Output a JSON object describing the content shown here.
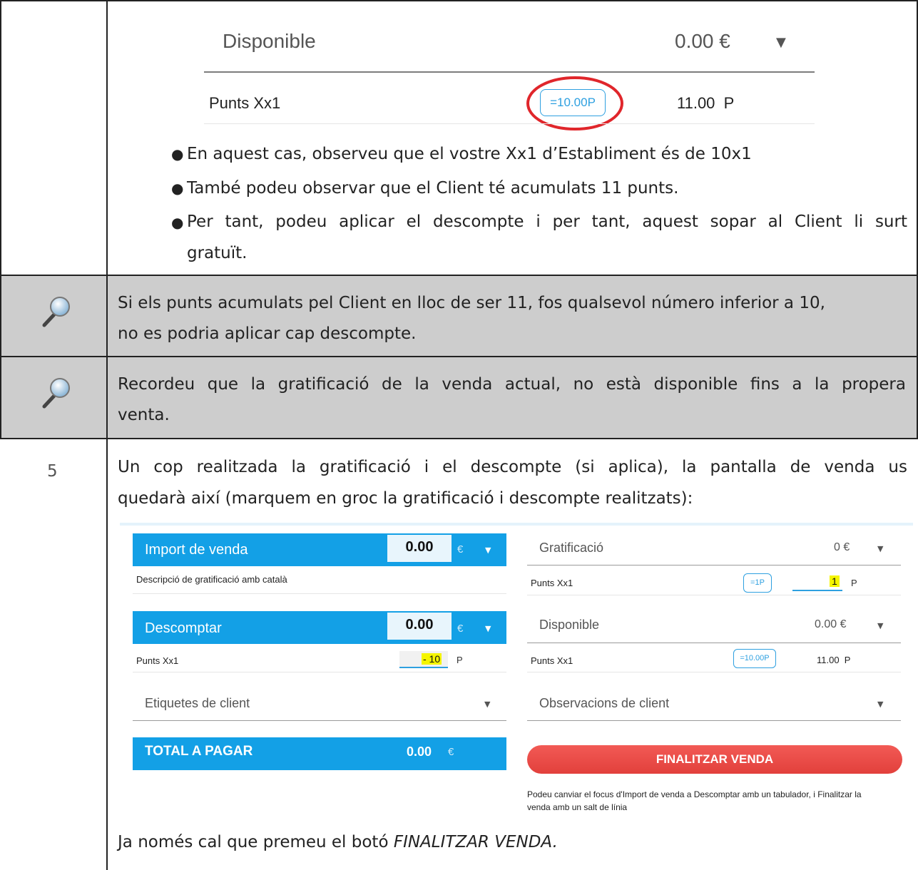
{
  "row_top": {
    "disponible_label": "Disponible",
    "disponible_value": "0.00 €",
    "punts_label": "Punts Xx1",
    "punts_pill": "=10.00P",
    "punts_value": "11.00  P",
    "bullets": [
      "En aquest cas, observeu que el vostre Xx1 d’Establiment és de 10x1",
      "També podeu observar que el Client té acumulats 11 punts.",
      "Per tant, podeu aplicar el descompte i per tant, aquest sopar al Client li surt",
      "gratuït."
    ]
  },
  "note1": {
    "line1": "Si els punts acumulats pel Client en lloc de ser 11, fos qualsevol número inferior a 10,",
    "line2": "no es podria aplicar cap descompte."
  },
  "note2": {
    "line1": "Recordeu que la gratificació de la venda actual, no està disponible fins a la propera",
    "line2": "venta."
  },
  "step5": {
    "number": "5",
    "intro_line1": "Un cop realitzada la gratificació i el descompte (si aplica), la pantalla de venda us",
    "intro_line2": "quedarà així (marquem en groc la gratificació i descompte realitzats):",
    "outro_prefix": "Ja només cal que premeu el botó ",
    "outro_italic": "FINALITZAR VENDA."
  },
  "sale_screen": {
    "import_label": "Import de venda",
    "import_value": "0.00",
    "currency": "€",
    "import_desc": "Descripció de gratificació amb català",
    "descomptar_label": "Descomptar",
    "descomptar_value": "0.00",
    "desc_punts_label": "Punts Xx1",
    "desc_punts_value": "- 10",
    "p_unit": "P",
    "etiquetes_label": "Etiquetes de client",
    "total_label": "TOTAL A PAGAR",
    "total_value": "0.00",
    "grat_label": "Gratificació",
    "grat_value": "0 €",
    "grat_punts_label": "Punts Xx1",
    "grat_pill": "=1P",
    "grat_punts_value": "1",
    "disp_label": "Disponible",
    "disp_value": "0.00 €",
    "disp_punts_label": "Punts Xx1",
    "disp_pill": "=10.00P",
    "disp_punts_value": "11.00  P",
    "observacions_label": "Observacions de client",
    "finalitzar_button": "FINALITZAR VENDA",
    "help_line1": "Podeu canviar el focus d'Import de venda a Descomptar amb un tabulador, i Finalitzar la",
    "help_line2": "venda amb un salt de línia"
  },
  "colors": {
    "accent_blue": "#13a0e6",
    "highlight_yellow": "#f5f500",
    "button_red": "#ea4a46",
    "note_gray": "#cdcdcd"
  }
}
